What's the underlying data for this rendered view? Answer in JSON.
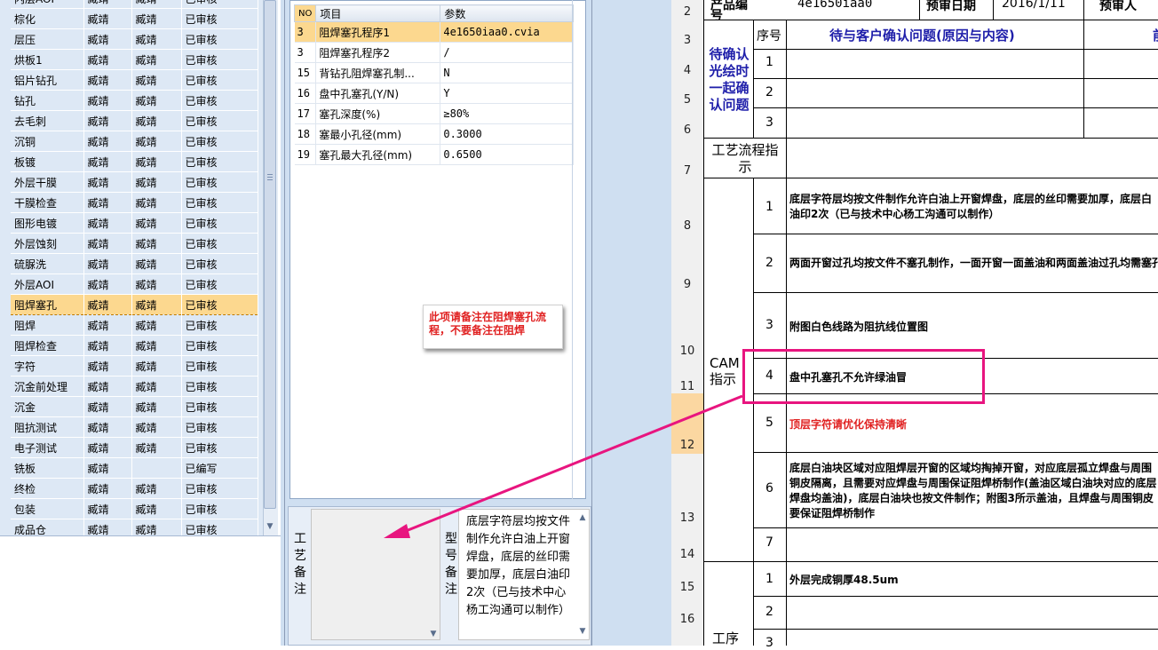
{
  "process_list": {
    "rows": [
      {
        "name": "内层AOI",
        "c1": "臧靖",
        "c2": "臧靖",
        "status": "已审核"
      },
      {
        "name": "棕化",
        "c1": "臧靖",
        "c2": "臧靖",
        "status": "已审核"
      },
      {
        "name": "层压",
        "c1": "臧靖",
        "c2": "臧靖",
        "status": "已审核"
      },
      {
        "name": "烘板1",
        "c1": "臧靖",
        "c2": "臧靖",
        "status": "已审核"
      },
      {
        "name": "铝片钻孔",
        "c1": "臧靖",
        "c2": "臧靖",
        "status": "已审核"
      },
      {
        "name": "钻孔",
        "c1": "臧靖",
        "c2": "臧靖",
        "status": "已审核"
      },
      {
        "name": "去毛刺",
        "c1": "臧靖",
        "c2": "臧靖",
        "status": "已审核"
      },
      {
        "name": "沉铜",
        "c1": "臧靖",
        "c2": "臧靖",
        "status": "已审核"
      },
      {
        "name": "板镀",
        "c1": "臧靖",
        "c2": "臧靖",
        "status": "已审核"
      },
      {
        "name": "外层干膜",
        "c1": "臧靖",
        "c2": "臧靖",
        "status": "已审核"
      },
      {
        "name": "干膜检查",
        "c1": "臧靖",
        "c2": "臧靖",
        "status": "已审核"
      },
      {
        "name": "图形电镀",
        "c1": "臧靖",
        "c2": "臧靖",
        "status": "已审核"
      },
      {
        "name": "外层蚀刻",
        "c1": "臧靖",
        "c2": "臧靖",
        "status": "已审核"
      },
      {
        "name": "硫脲洗",
        "c1": "臧靖",
        "c2": "臧靖",
        "status": "已审核"
      },
      {
        "name": "外层AOI",
        "c1": "臧靖",
        "c2": "臧靖",
        "status": "已审核"
      },
      {
        "name": "阻焊塞孔",
        "c1": "臧靖",
        "c2": "臧靖",
        "status": "已审核",
        "selected": true
      },
      {
        "name": "阻焊",
        "c1": "臧靖",
        "c2": "臧靖",
        "status": "已审核"
      },
      {
        "name": "阻焊检查",
        "c1": "臧靖",
        "c2": "臧靖",
        "status": "已审核"
      },
      {
        "name": "字符",
        "c1": "臧靖",
        "c2": "臧靖",
        "status": "已审核"
      },
      {
        "name": "沉金前处理",
        "c1": "臧靖",
        "c2": "臧靖",
        "status": "已审核"
      },
      {
        "name": "沉金",
        "c1": "臧靖",
        "c2": "臧靖",
        "status": "已审核"
      },
      {
        "name": "阻抗测试",
        "c1": "臧靖",
        "c2": "臧靖",
        "status": "已审核"
      },
      {
        "name": "电子测试",
        "c1": "臧靖",
        "c2": "臧靖",
        "status": "已审核"
      },
      {
        "name": "铣板",
        "c1": "臧靖",
        "c2": "",
        "status": "已编写"
      },
      {
        "name": "终检",
        "c1": "臧靖",
        "c2": "臧靖",
        "status": "已审核"
      },
      {
        "name": "包装",
        "c1": "臧靖",
        "c2": "臧靖",
        "status": "已审核"
      },
      {
        "name": "成品仓",
        "c1": "臧靖",
        "c2": "臧靖",
        "status": "已审核"
      }
    ]
  },
  "params": {
    "headers": {
      "no": "NO",
      "item": "项目",
      "value": "参数"
    },
    "rows": [
      {
        "no": "3",
        "item": "阻焊塞孔程序1",
        "value": "4e1650iaa0.cvia"
      },
      {
        "no": "3",
        "item": "阻焊塞孔程序2",
        "value": "/"
      },
      {
        "no": "15",
        "item": "背钻孔阻焊塞孔制...",
        "value": "N"
      },
      {
        "no": "16",
        "item": "盘中孔塞孔(Y/N)",
        "value": "Y"
      },
      {
        "no": "17",
        "item": "塞孔深度(%)",
        "value": "≥80%"
      },
      {
        "no": "18",
        "item": "塞最小孔径(mm)",
        "value": "0.3000"
      },
      {
        "no": "19",
        "item": "塞孔最大孔径(mm)",
        "value": "0.6500"
      }
    ]
  },
  "callout": {
    "text": "此项请备注在阻焊塞孔流程，不要备注在阻焊"
  },
  "notes": {
    "process_note_label": "工艺备注",
    "model_note_label": "型号备注",
    "model_note_text": "底层字符层均按文件制作允许白油上开窗焊盘，底层的丝印需要加厚，底层白油印2次（已与技术中心杨工沟通可以制作）"
  },
  "sheet": {
    "row_numbers": [
      "2",
      "3",
      "4",
      "5",
      "6",
      "7",
      "8",
      "9",
      "10",
      "11",
      "12",
      "13",
      "14",
      "15",
      "16"
    ],
    "header_row": {
      "label": "产品编号",
      "part_no": "4e1650iaa0",
      "date_label": "预审日期",
      "date": "2016/1/11",
      "reviewer_label": "预审人"
    },
    "confirm": {
      "section": "待确认光绘时一起确认问题",
      "col_seq": "序号",
      "col_issue": "待与客户确认问题(原因与内容)",
      "col_extra": "前",
      "rows": [
        "1",
        "2",
        "3"
      ]
    },
    "process_flow": {
      "label": "工艺流程指示"
    },
    "cam": {
      "label": "CAM指示",
      "items": [
        {
          "seq": "1",
          "text": "底层字符层均按文件制作允许白油上开窗焊盘，底层的丝印需要加厚，底层白油印2次（已与技术中心杨工沟通可以制作）",
          "red": false
        },
        {
          "seq": "2",
          "text": "两面开窗过孔均按文件不塞孔制作，一面开窗一面盖油和两面盖油过孔均需塞孔",
          "red": false
        },
        {
          "seq": "3",
          "text": "附图白色线路为阻抗线位置图",
          "red": false
        },
        {
          "seq": "4",
          "text": "盘中孔塞孔不允许绿油冒",
          "red": false
        },
        {
          "seq": "5",
          "text": "顶层字符请优化保持清晰",
          "red": true
        },
        {
          "seq": "6",
          "text": "底层白油块区域对应阻焊层开窗的区域均掏掉开窗，对应底层孤立焊盘与周围铜皮隔离，且需要对应焊盘与周围保证阻焊桥制作(盖油区域白油块对应的底层焊盘均盖油)，底层白油块也按文件制作；附图3所示盖油，且焊盘与周围铜皮要保证阻焊桥制作",
          "red": false
        },
        {
          "seq": "7",
          "text": "",
          "red": false
        }
      ]
    },
    "process": {
      "label": "工序",
      "items": [
        {
          "seq": "1",
          "text": "外层完成铜厚48.5um"
        },
        {
          "seq": "2",
          "text": ""
        },
        {
          "seq": "3",
          "text": ""
        }
      ]
    }
  },
  "colors": {
    "highlight": "#e8157f",
    "selected_row": "#fcd88f",
    "blue_text": "#1f1faa",
    "red_text": "#e02020"
  }
}
